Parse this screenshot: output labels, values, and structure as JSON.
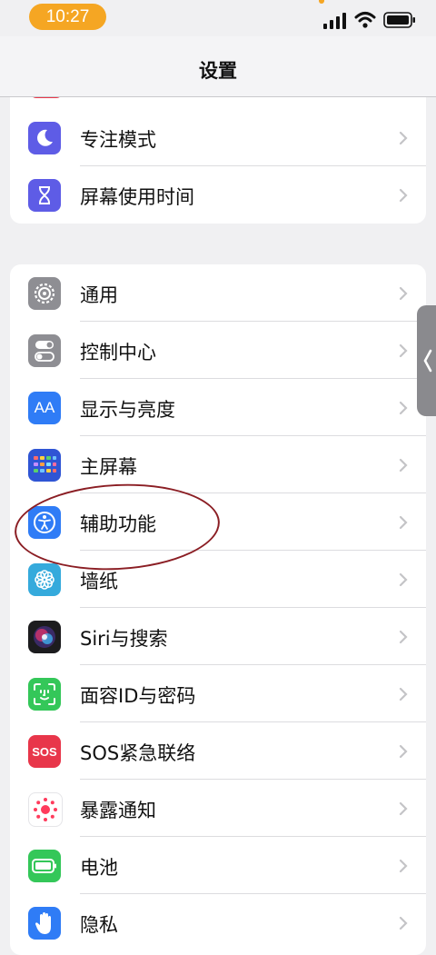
{
  "status_bar": {
    "time": "10:27"
  },
  "nav": {
    "title": "设置"
  },
  "group1": [
    {
      "label": "专注模式",
      "icon": "moon-icon",
      "color": "#5e5ce6"
    },
    {
      "label": "屏幕使用时间",
      "icon": "hourglass-icon",
      "color": "#5e5ce6"
    }
  ],
  "group2": [
    {
      "label": "通用",
      "icon": "gear-icon",
      "color": "#8e8e93"
    },
    {
      "label": "控制中心",
      "icon": "toggles-icon",
      "color": "#8e8e93"
    },
    {
      "label": "显示与亮度",
      "icon": "aa-icon",
      "color": "#2f7cf6"
    },
    {
      "label": "主屏幕",
      "icon": "grid-icon",
      "color": "#2f55d4"
    },
    {
      "label": "辅助功能",
      "icon": "accessibility-icon",
      "color": "#2f7cf6"
    },
    {
      "label": "墙纸",
      "icon": "flower-icon",
      "color": "#35aadc"
    },
    {
      "label": "Siri与搜索",
      "icon": "siri-icon",
      "color": "#1c1c1e"
    },
    {
      "label": "面容ID与密码",
      "icon": "faceid-icon",
      "color": "#34c759"
    },
    {
      "label": "SOS紧急联络",
      "icon": "sos-icon",
      "color": "#e8364a"
    },
    {
      "label": "暴露通知",
      "icon": "exposure-icon",
      "color": "#ffffff"
    },
    {
      "label": "电池",
      "icon": "battery-icon",
      "color": "#34c759"
    },
    {
      "label": "隐私",
      "icon": "hand-icon",
      "color": "#2f7cf6"
    }
  ],
  "icons_text": {
    "aa": "AA",
    "sos": "SOS"
  }
}
